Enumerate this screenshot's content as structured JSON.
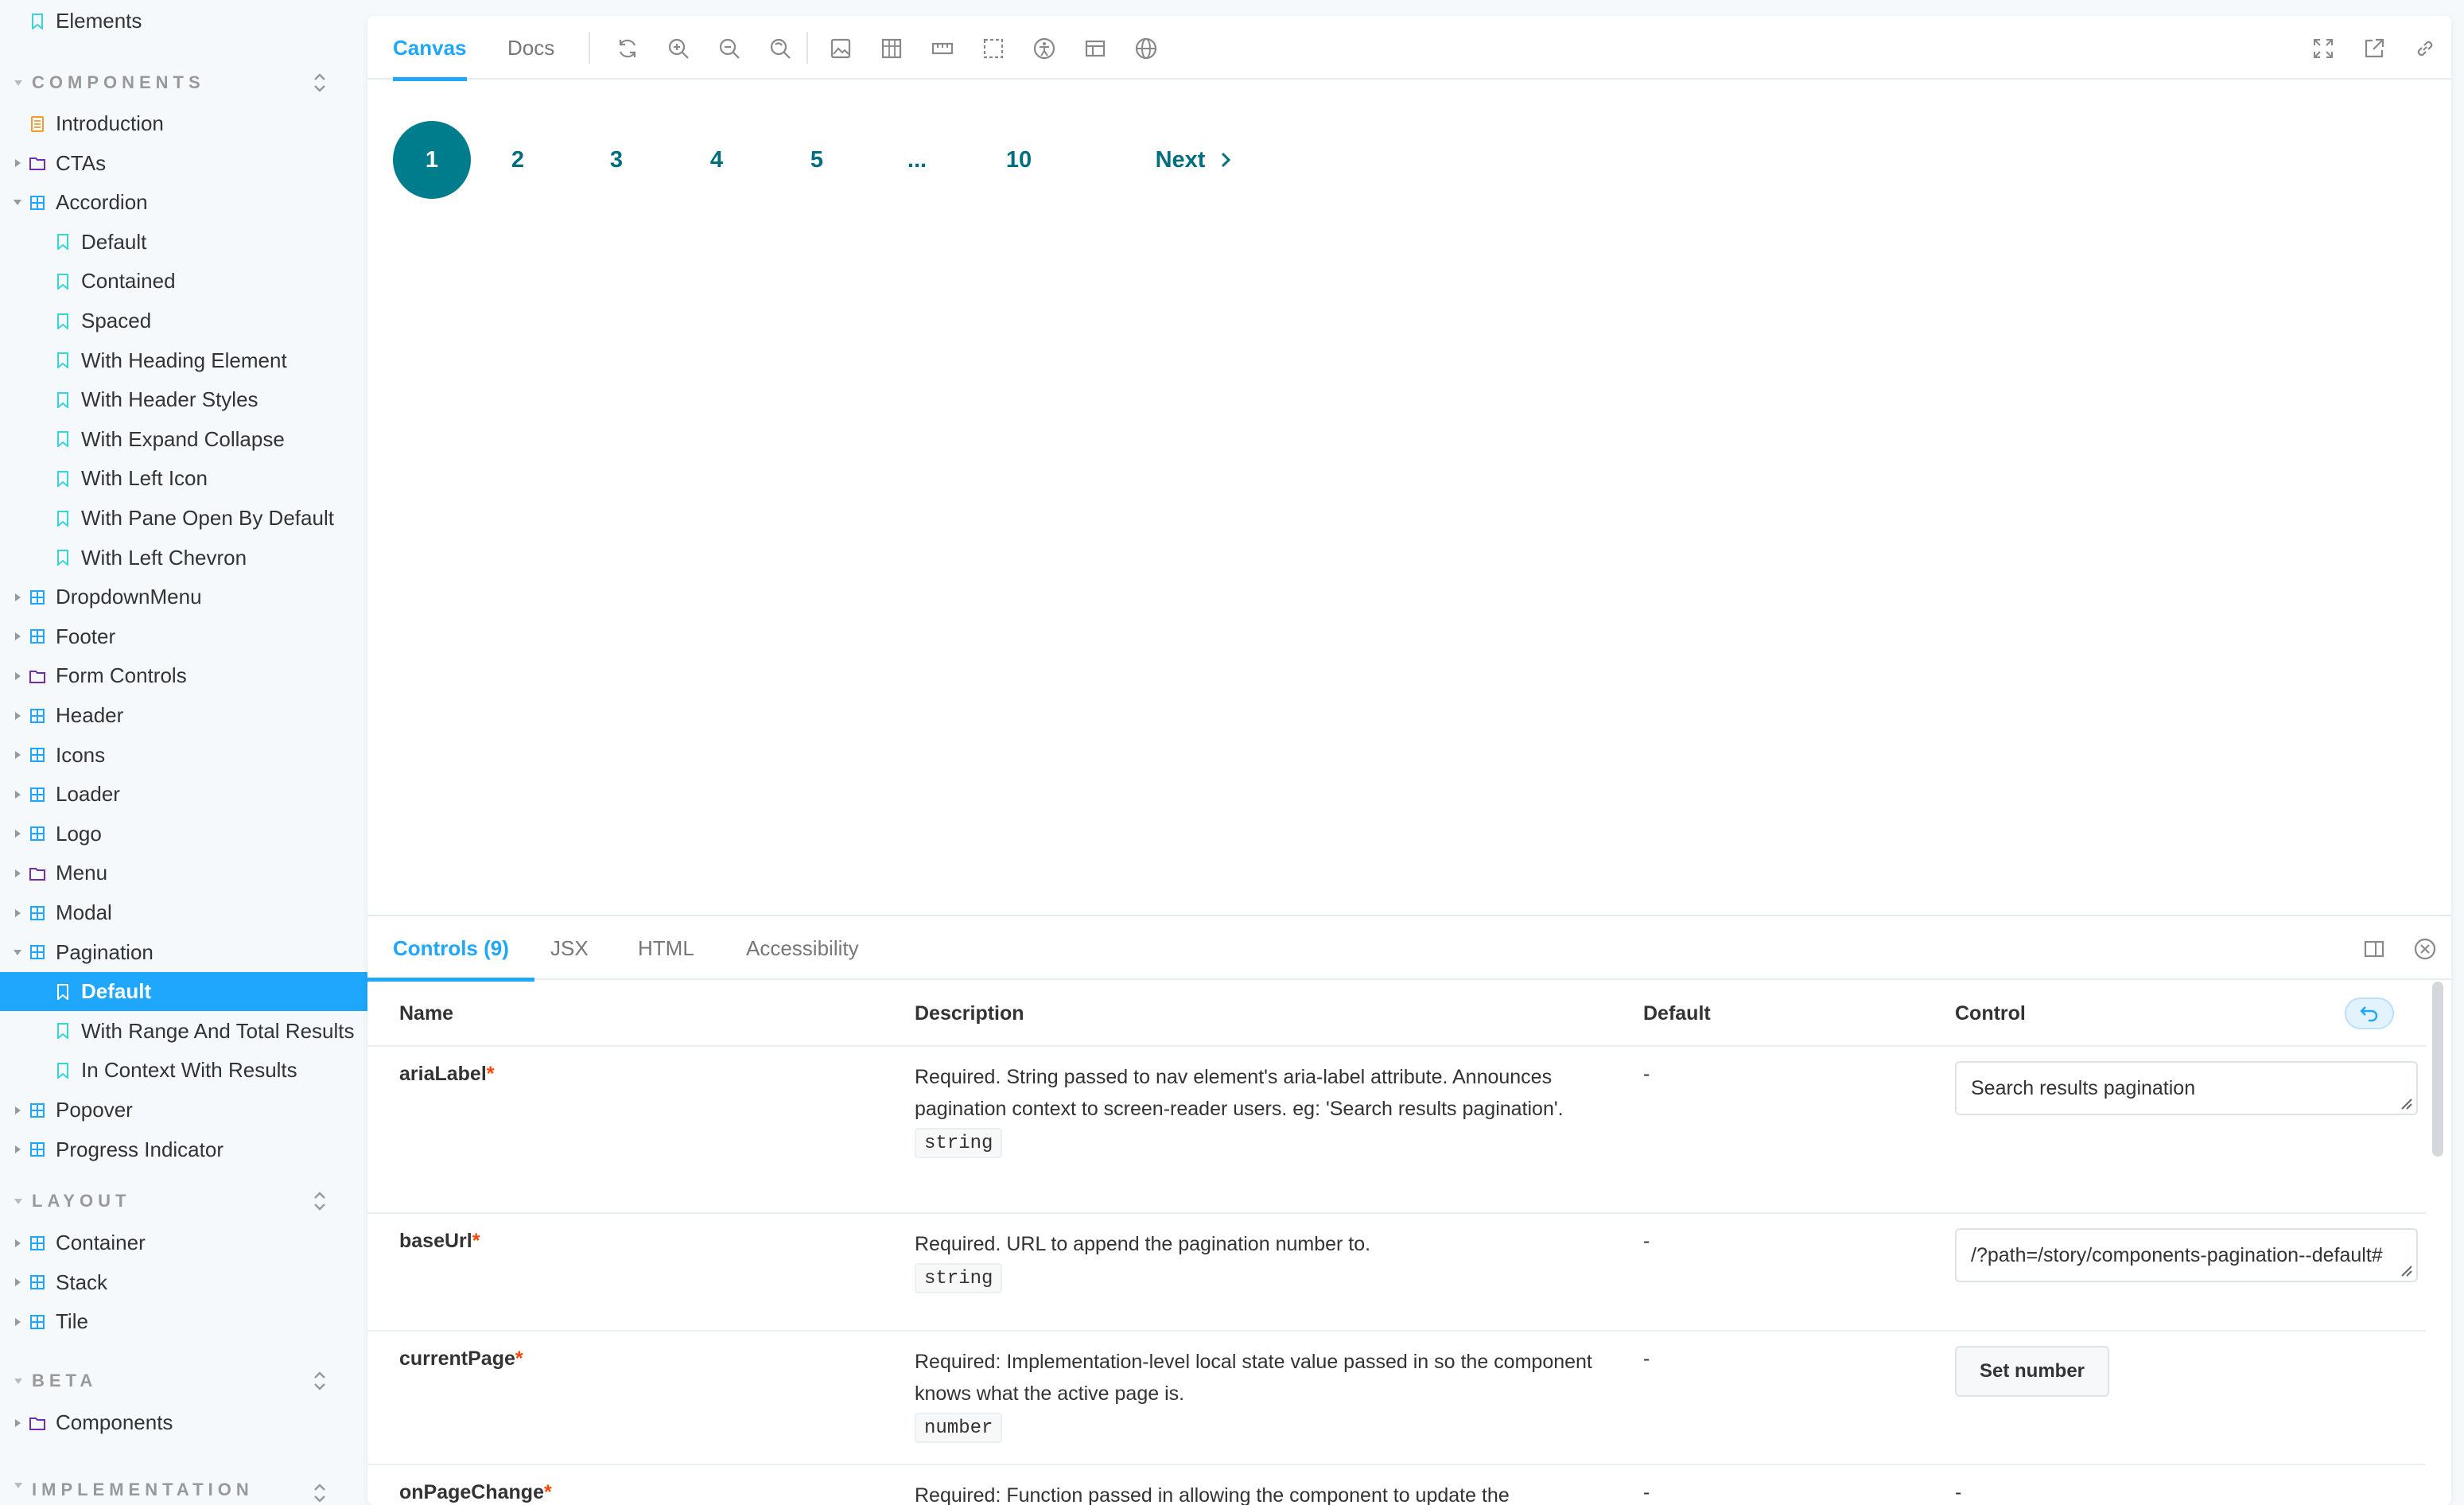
{
  "sidebar": {
    "top_item": "Elements",
    "sections": {
      "components": "COMPONENTS",
      "layout": "LAYOUT",
      "beta": "BETA",
      "implementation": "IMPLEMENTATION DEMOS"
    },
    "components": [
      {
        "label": "Introduction",
        "kind": "doc"
      },
      {
        "label": "CTAs",
        "kind": "folder"
      },
      {
        "label": "Accordion",
        "kind": "component",
        "expanded": true
      },
      {
        "label": "Default",
        "kind": "story"
      },
      {
        "label": "Contained",
        "kind": "story"
      },
      {
        "label": "Spaced",
        "kind": "story"
      },
      {
        "label": "With Heading Element",
        "kind": "story"
      },
      {
        "label": "With Header Styles",
        "kind": "story"
      },
      {
        "label": "With Expand Collapse",
        "kind": "story"
      },
      {
        "label": "With Left Icon",
        "kind": "story"
      },
      {
        "label": "With Pane Open By Default",
        "kind": "story"
      },
      {
        "label": "With Left Chevron",
        "kind": "story"
      },
      {
        "label": "DropdownMenu",
        "kind": "component"
      },
      {
        "label": "Footer",
        "kind": "component"
      },
      {
        "label": "Form Controls",
        "kind": "folder"
      },
      {
        "label": "Header",
        "kind": "component"
      },
      {
        "label": "Icons",
        "kind": "component"
      },
      {
        "label": "Loader",
        "kind": "component"
      },
      {
        "label": "Logo",
        "kind": "component"
      },
      {
        "label": "Menu",
        "kind": "folder"
      },
      {
        "label": "Modal",
        "kind": "component"
      },
      {
        "label": "Pagination",
        "kind": "component",
        "expanded": true
      },
      {
        "label": "Default",
        "kind": "story",
        "selected": true
      },
      {
        "label": "With Range And Total Results",
        "kind": "story"
      },
      {
        "label": "In Context With Results",
        "kind": "story"
      },
      {
        "label": "Popover",
        "kind": "component"
      },
      {
        "label": "Progress Indicator",
        "kind": "component"
      }
    ],
    "layout": [
      {
        "label": "Container",
        "kind": "component"
      },
      {
        "label": "Stack",
        "kind": "component"
      },
      {
        "label": "Tile",
        "kind": "component"
      }
    ],
    "beta": [
      {
        "label": "Components",
        "kind": "folder"
      }
    ]
  },
  "toolbar": {
    "tab_canvas": "Canvas",
    "tab_docs": "Docs",
    "icons": [
      "reload-icon",
      "zoom-in-icon",
      "zoom-out-icon",
      "zoom-reset-icon",
      "background-icon",
      "viewport-icon",
      "measure-icon",
      "outline-icon",
      "accessibility-icon",
      "layout-icon",
      "globe-icon"
    ],
    "right_icons": [
      "fullscreen-icon",
      "open-new-tab-icon",
      "copy-link-icon"
    ]
  },
  "pagination": {
    "pages": [
      "1",
      "2",
      "3",
      "4",
      "5",
      "...",
      "10"
    ],
    "active": "1",
    "next_label": "Next"
  },
  "addons": {
    "tab_controls": "Controls (9)",
    "tab_jsx": "JSX",
    "tab_html": "HTML",
    "tab_accessibility": "Accessibility",
    "columns": {
      "name": "Name",
      "description": "Description",
      "default": "Default",
      "control": "Control"
    },
    "rows": [
      {
        "name": "ariaLabel",
        "required": "*",
        "description": "Required. String passed to nav element's aria-label attribute. Announces pagination context to screen-reader users. eg: 'Search results pagination'.",
        "type": "string",
        "default": "-",
        "control_value": "Search results pagination"
      },
      {
        "name": "baseUrl",
        "required": "*",
        "description": "Required. URL to append the pagination number to.",
        "type": "string",
        "default": "-",
        "control_value": "/?path=/story/components-pagination--default#"
      },
      {
        "name": "currentPage",
        "required": "*",
        "description": "Required: Implementation-level local state value passed in so the component knows what the active page is.",
        "type": "number",
        "default": "-",
        "control_button": "Set number"
      },
      {
        "name": "onPageChange",
        "required": "*",
        "description": "Required: Function passed in allowing the component to update the",
        "default": "-",
        "control_value": "-"
      }
    ]
  },
  "colors": {
    "accent": "#1ea7fd",
    "pagination_active": "#007d8c",
    "pagination_text": "#006e7f",
    "required": "#ff4400",
    "doc_icon": "#f59b2c",
    "folder_icon": "#6f2cac",
    "component_icon": "#1ea7fd",
    "story_icon": "#37d5d3"
  }
}
